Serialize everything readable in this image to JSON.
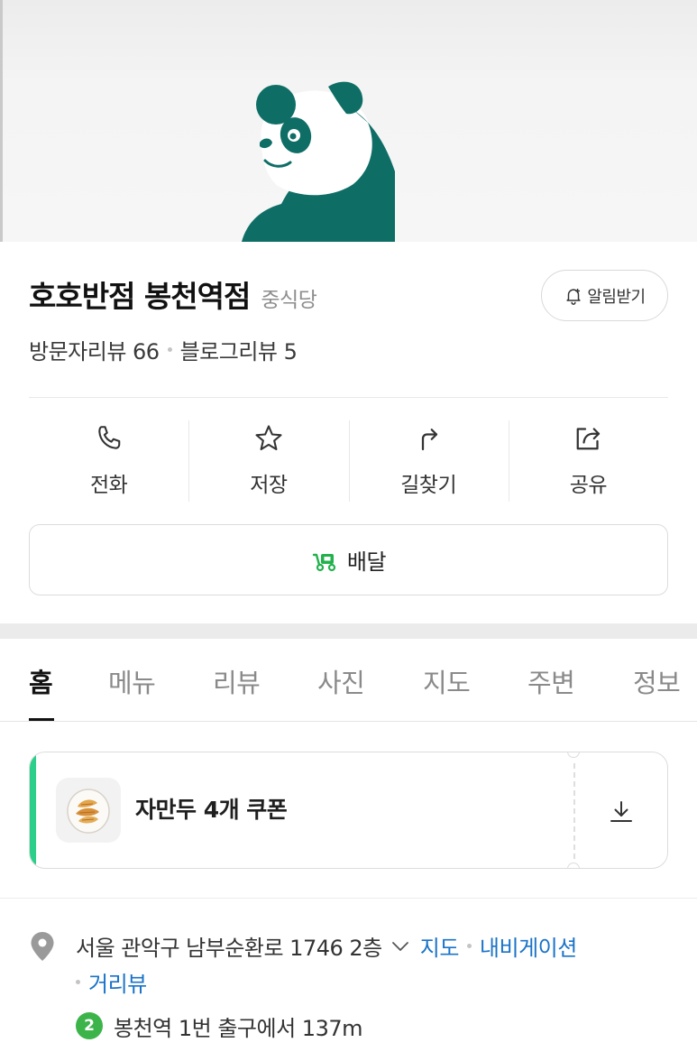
{
  "place": {
    "name": "호호반점 봉천역점",
    "category": "중식당",
    "alarm_label": "알림받기",
    "visitor_reviews": "방문자리뷰 66",
    "blog_reviews": "블로그리뷰 5"
  },
  "actions": [
    {
      "label": "전화",
      "icon": "phone-icon"
    },
    {
      "label": "저장",
      "icon": "star-icon"
    },
    {
      "label": "길찾기",
      "icon": "directions-icon"
    },
    {
      "label": "공유",
      "icon": "share-icon"
    }
  ],
  "delivery": {
    "label": "배달",
    "icon": "delivery-truck-icon"
  },
  "tabs": [
    {
      "label": "홈",
      "active": true
    },
    {
      "label": "메뉴",
      "active": false
    },
    {
      "label": "리뷰",
      "active": false
    },
    {
      "label": "사진",
      "active": false
    },
    {
      "label": "지도",
      "active": false
    },
    {
      "label": "주변",
      "active": false
    },
    {
      "label": "정보",
      "active": false
    }
  ],
  "coupon": {
    "title": "자만두 4개 쿠폰",
    "accent_color": "#2bcf8a"
  },
  "address": {
    "text": "서울 관악구 남부순환로 1746 2층",
    "map_link": "지도",
    "navigation_link": "내비게이션",
    "street_view_link": "거리뷰",
    "subway_line": "2",
    "subway_line_color": "#3cb44a",
    "station_info": "봉천역 1번 출구에서 137m"
  },
  "colors": {
    "brand_teal": "#0e6e66",
    "link_blue": "#1a73c8",
    "delivery_green": "#22b14c"
  }
}
